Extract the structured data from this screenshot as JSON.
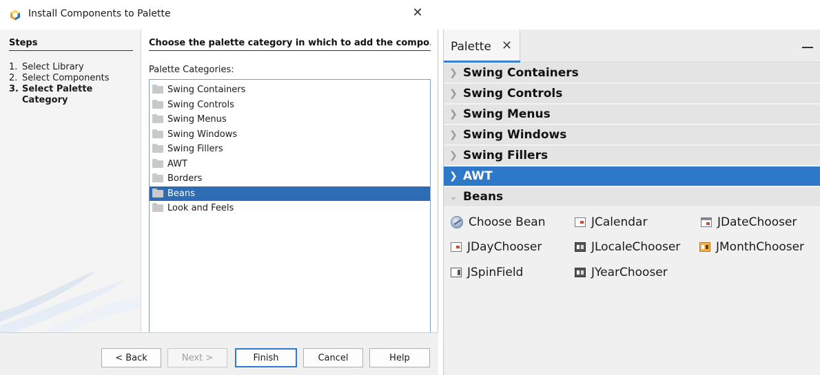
{
  "dialog": {
    "title": "Install Components to Palette",
    "close_glyph": "✕",
    "steps_heading": "Steps",
    "steps": [
      {
        "num": "1.",
        "label": "Select Library",
        "current": false
      },
      {
        "num": "2.",
        "label": "Select Components",
        "current": false
      },
      {
        "num": "3.",
        "label": "Select Palette Category",
        "current": true
      }
    ],
    "content_heading": "Choose the palette category in which to add the compo...",
    "categories_label": "Palette Categories:",
    "categories": [
      {
        "label": "Swing Containers",
        "selected": false
      },
      {
        "label": "Swing Controls",
        "selected": false
      },
      {
        "label": "Swing Menus",
        "selected": false
      },
      {
        "label": "Swing Windows",
        "selected": false
      },
      {
        "label": "Swing Fillers",
        "selected": false
      },
      {
        "label": "AWT",
        "selected": false
      },
      {
        "label": "Borders",
        "selected": false
      },
      {
        "label": "Beans",
        "selected": true
      },
      {
        "label": "Look and Feels",
        "selected": false
      }
    ],
    "buttons": {
      "back": "< Back",
      "next": "Next >",
      "finish": "Finish",
      "cancel": "Cancel",
      "help": "Help"
    }
  },
  "palette": {
    "tab_label": "Palette",
    "tab_close": "✕",
    "categories": [
      {
        "label": "Swing Containers",
        "expanded": false,
        "selected": false
      },
      {
        "label": "Swing Controls",
        "expanded": false,
        "selected": false
      },
      {
        "label": "Swing Menus",
        "expanded": false,
        "selected": false
      },
      {
        "label": "Swing Windows",
        "expanded": false,
        "selected": false
      },
      {
        "label": "Swing Fillers",
        "expanded": false,
        "selected": false
      },
      {
        "label": "AWT",
        "expanded": false,
        "selected": true
      },
      {
        "label": "Beans",
        "expanded": true,
        "selected": false
      }
    ],
    "beans": [
      {
        "label": "Choose Bean",
        "icon": "bean-icon"
      },
      {
        "label": "JCalendar",
        "icon": "calendar-icon"
      },
      {
        "label": "JDateChooser",
        "icon": "date-chooser-icon"
      },
      {
        "label": "JDayChooser",
        "icon": "day-chooser-icon"
      },
      {
        "label": "JLocaleChooser",
        "icon": "locale-chooser-icon"
      },
      {
        "label": "JMonthChooser",
        "icon": "month-chooser-icon"
      },
      {
        "label": "JSpinField",
        "icon": "spin-field-icon"
      },
      {
        "label": "JYearChooser",
        "icon": "year-chooser-icon"
      }
    ]
  },
  "colors": {
    "selection": "#2e6db4",
    "palette_selection": "#2e78c8",
    "accent": "#3c7fd0"
  }
}
